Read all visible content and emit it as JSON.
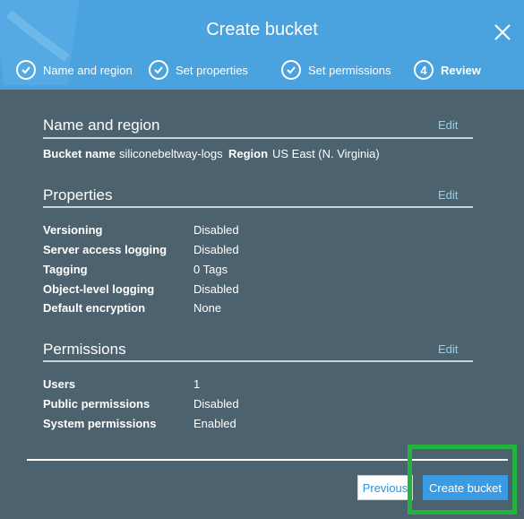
{
  "dialog": {
    "title": "Create bucket",
    "close_icon": "close-icon"
  },
  "wizard": {
    "steps": [
      {
        "label": "Name and region",
        "state": "done",
        "icon": "checkmark-icon"
      },
      {
        "label": "Set properties",
        "state": "done",
        "icon": "checkmark-icon"
      },
      {
        "label": "Set permissions",
        "state": "done",
        "icon": "checkmark-icon"
      },
      {
        "label": "Review",
        "state": "current",
        "number": "4"
      }
    ]
  },
  "name_region": {
    "title": "Name and region",
    "edit_label": "Edit",
    "bucket_name_label": "Bucket name",
    "bucket_name_value": "siliconebeltway-logs",
    "region_label": "Region",
    "region_value": "US East (N. Virginia)"
  },
  "properties": {
    "title": "Properties",
    "edit_label": "Edit",
    "rows": [
      {
        "label": "Versioning",
        "value": "Disabled"
      },
      {
        "label": "Server access logging",
        "value": "Disabled"
      },
      {
        "label": "Tagging",
        "value": "0 Tags"
      },
      {
        "label": "Object-level logging",
        "value": "Disabled"
      },
      {
        "label": "Default encryption",
        "value": "None"
      }
    ]
  },
  "permissions": {
    "title": "Permissions",
    "edit_label": "Edit",
    "rows": [
      {
        "label": "Users",
        "value": "1"
      },
      {
        "label": "Public permissions",
        "value": "Disabled"
      },
      {
        "label": "System permissions",
        "value": "Enabled"
      }
    ]
  },
  "footer": {
    "previous_label": "Previous",
    "create_label": "Create bucket"
  },
  "colors": {
    "header": "#4aa3df",
    "body": "#4c636f",
    "link": "#8fd0f4",
    "primary_button": "#3b9be2",
    "highlight": "#22b33c"
  }
}
